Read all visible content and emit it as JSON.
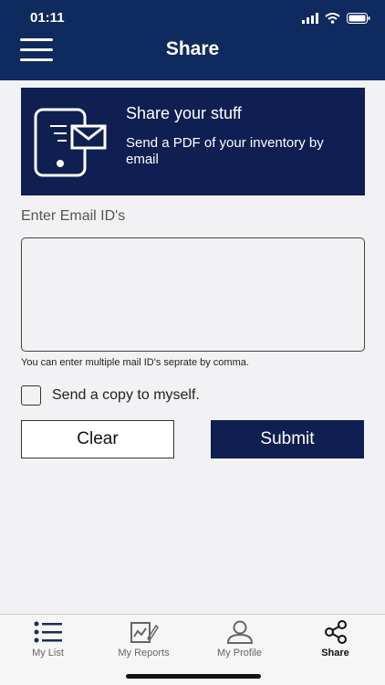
{
  "status_bar": {
    "time": "01:11"
  },
  "header": {
    "title": "Share"
  },
  "banner": {
    "title": "Share your stuff",
    "text": "Send a PDF of your inventory by email"
  },
  "form": {
    "email_label": "Enter Email ID's",
    "email_value": "",
    "hint": "You can enter multiple mail ID's seprate by comma.",
    "copy_label": "Send a copy to myself.",
    "copy_checked": false
  },
  "buttons": {
    "clear": "Clear",
    "submit": "Submit"
  },
  "tabs": [
    {
      "label": "My List",
      "icon": "list-icon"
    },
    {
      "label": "My Reports",
      "icon": "reports-icon"
    },
    {
      "label": "My Profile",
      "icon": "profile-icon"
    },
    {
      "label": "Share",
      "icon": "share-icon",
      "active": true
    }
  ],
  "colors": {
    "header": "#0f2a5e",
    "accent": "#0f1f52",
    "background": "#f2f2f4"
  }
}
